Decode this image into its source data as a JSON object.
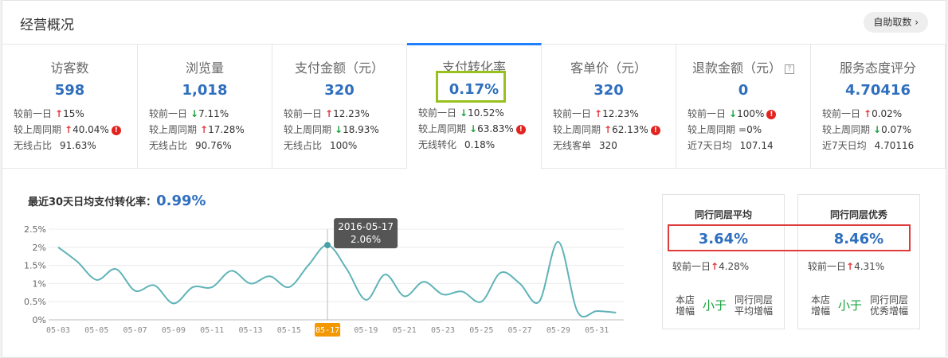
{
  "header": {
    "title": "经营概况",
    "button_label": "自助取数 ›"
  },
  "metrics": [
    {
      "title": "访客数",
      "value": "598",
      "help": "",
      "rows": [
        {
          "label": "较前一日",
          "dir": "up",
          "delta": "15%",
          "warn": false
        },
        {
          "label": "较上周同期",
          "dir": "up",
          "delta": "40.04%",
          "warn": true
        },
        {
          "label": "无线占比",
          "dir": "",
          "delta": "91.63%",
          "warn": false
        }
      ]
    },
    {
      "title": "浏览量",
      "value": "1,018",
      "help": "",
      "rows": [
        {
          "label": "较前一日",
          "dir": "down",
          "delta": "7.11%",
          "warn": false
        },
        {
          "label": "较上周同期",
          "dir": "up",
          "delta": "17.28%",
          "warn": false
        },
        {
          "label": "无线占比",
          "dir": "",
          "delta": "90.76%",
          "warn": false
        }
      ]
    },
    {
      "title": "支付金额（元）",
      "value": "320",
      "help": "",
      "rows": [
        {
          "label": "较前一日",
          "dir": "up",
          "delta": "12.23%",
          "warn": false
        },
        {
          "label": "较上周同期",
          "dir": "down",
          "delta": "18.93%",
          "warn": false
        },
        {
          "label": "无线占比",
          "dir": "",
          "delta": "100%",
          "warn": false
        }
      ]
    },
    {
      "title": "支付转化率",
      "value": "0.17%",
      "help": "",
      "rows": [
        {
          "label": "较前一日",
          "dir": "down",
          "delta": "10.52%",
          "warn": false
        },
        {
          "label": "较上周同期",
          "dir": "down",
          "delta": "63.83%",
          "warn": true
        },
        {
          "label": "无线转化",
          "dir": "",
          "delta": "0.18%",
          "warn": false
        }
      ]
    },
    {
      "title": "客单价（元）",
      "value": "320",
      "help": "",
      "rows": [
        {
          "label": "较前一日",
          "dir": "up",
          "delta": "12.23%",
          "warn": false
        },
        {
          "label": "较上周同期",
          "dir": "up",
          "delta": "62.13%",
          "warn": true
        },
        {
          "label": "无线客单",
          "dir": "",
          "delta": "320",
          "warn": false
        }
      ]
    },
    {
      "title": "退款金额（元）",
      "value": "0",
      "help": "?",
      "rows": [
        {
          "label": "较前一日",
          "dir": "down",
          "delta": "100%",
          "warn": true
        },
        {
          "label": "较上周同期",
          "dir": "eq",
          "delta": "0%",
          "warn": false
        },
        {
          "label": "近7天日均",
          "dir": "",
          "delta": "107.14",
          "warn": false
        }
      ]
    },
    {
      "title": "服务态度评分",
      "value": "4.70416",
      "help": "",
      "rows": [
        {
          "label": "较前一日",
          "dir": "up",
          "delta": "0.02%",
          "warn": false
        },
        {
          "label": "较上周同期",
          "dir": "down",
          "delta": "0.07%",
          "warn": false
        },
        {
          "label": "近7天日均",
          "dir": "",
          "delta": "4.70116",
          "warn": false
        }
      ]
    }
  ],
  "glyphs": {
    "up": "↑",
    "down": "↓",
    "eq": "=",
    "warn": "!"
  },
  "colors": {
    "accent": "#2f6fbd",
    "tab_active": "#1f80ff",
    "up": "#e3393c",
    "down": "#16a23b",
    "line": "#5fb3b8",
    "highlight_green": "#98c11f",
    "highlight_red": "#e03a3a",
    "tooltip_bg": "#555555",
    "selected_tick_bg": "#f39800"
  },
  "chart_title": {
    "label": "最近30天日均支付转化率：",
    "value": "0.99%"
  },
  "chart_data": {
    "type": "line",
    "x": [
      "05-03",
      "05-04",
      "05-05",
      "05-06",
      "05-07",
      "05-08",
      "05-09",
      "05-10",
      "05-11",
      "05-12",
      "05-13",
      "05-14",
      "05-15",
      "05-16",
      "05-17",
      "05-18",
      "05-19",
      "05-20",
      "05-21",
      "05-22",
      "05-23",
      "05-24",
      "05-25",
      "05-26",
      "05-27",
      "05-28",
      "05-29",
      "05-30",
      "05-31",
      "06-01"
    ],
    "x_tick_labels": [
      "05-03",
      "05-05",
      "05-07",
      "05-09",
      "05-11",
      "05-13",
      "05-15",
      "05-17",
      "05-19",
      "05-21",
      "05-23",
      "05-25",
      "05-27",
      "05-29",
      "05-31"
    ],
    "y_tick_labels": [
      "0%",
      "0.5%",
      "1%",
      "1.5%",
      "2%",
      "2.5%"
    ],
    "ylim": [
      0,
      2.5
    ],
    "values": [
      2.0,
      1.6,
      1.1,
      1.4,
      0.8,
      0.95,
      0.45,
      0.9,
      0.9,
      1.35,
      1.0,
      1.2,
      0.9,
      1.5,
      2.06,
      1.4,
      0.55,
      1.25,
      0.65,
      1.05,
      0.7,
      0.78,
      0.5,
      1.3,
      1.0,
      0.5,
      2.15,
      0.22,
      0.24,
      0.2
    ],
    "selected": {
      "x": "05-17",
      "tooltip_date": "2016-05-17",
      "tooltip_value": "2.06%"
    },
    "grid": true
  },
  "peers": [
    {
      "title": "同行同层平均",
      "value": "3.64%",
      "compare_label": "较前一日",
      "compare_dir": "up",
      "compare_delta": "4.28%",
      "a": "本店增幅",
      "op": "小于",
      "b": "同行同层平均增幅"
    },
    {
      "title": "同行同层优秀",
      "value": "8.46%",
      "compare_label": "较前一日",
      "compare_dir": "up",
      "compare_delta": "4.31%",
      "a": "本店增幅",
      "op": "小于",
      "b": "同行同层优秀增幅"
    }
  ]
}
